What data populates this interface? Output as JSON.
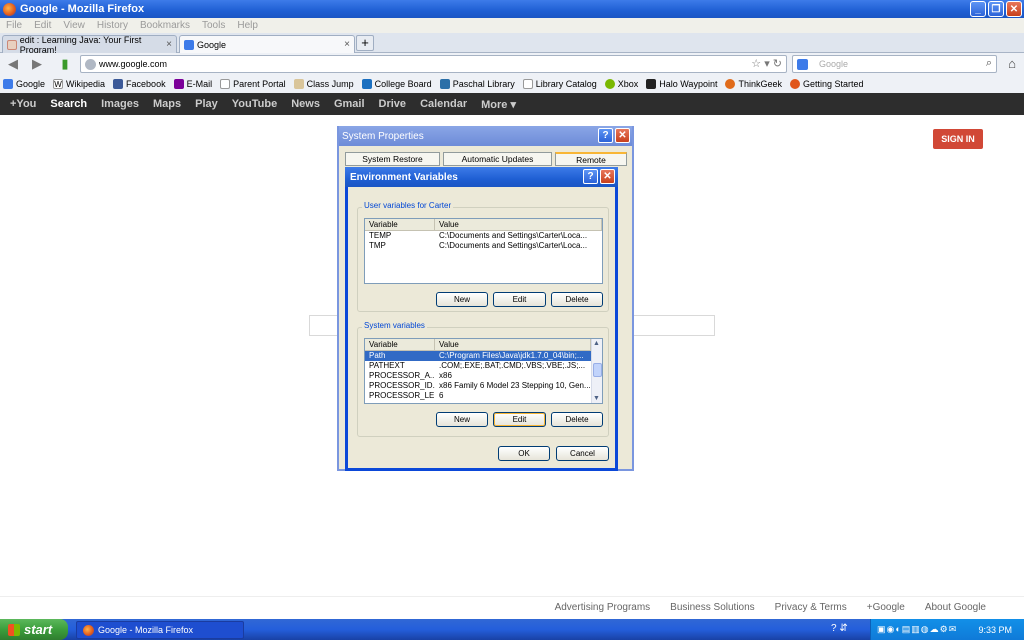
{
  "window": {
    "title": "Google - Mozilla Firefox"
  },
  "menu": [
    "File",
    "Edit",
    "View",
    "History",
    "Bookmarks",
    "Tools",
    "Help"
  ],
  "tabs": [
    {
      "label": "edit : Learning Java: Your First Program!"
    },
    {
      "label": "Google"
    }
  ],
  "nav": {
    "url": "www.google.com",
    "search_placeholder": "Google"
  },
  "bookmarks": [
    "Google",
    "Wikipedia",
    "Facebook",
    "E-Mail",
    "Parent Portal",
    "Class Jump",
    "College Board",
    "Paschal Library",
    "Library Catalog",
    "Xbox",
    "Halo Waypoint",
    "ThinkGeek",
    "Getting Started"
  ],
  "gbar": [
    "+You",
    "Search",
    "Images",
    "Maps",
    "Play",
    "YouTube",
    "News",
    "Gmail",
    "Drive",
    "Calendar",
    "More ▾"
  ],
  "signin": "SIGN IN",
  "footer": [
    "Advertising Programs",
    "Business Solutions",
    "Privacy & Terms",
    "+Google",
    "About Google"
  ],
  "sysprop": {
    "title": "System Properties",
    "tabs": [
      "System Restore",
      "Automatic Updates",
      "Remote"
    ]
  },
  "envvar": {
    "title": "Environment Variables",
    "user_group": "User variables for Carter",
    "system_group": "System variables",
    "col_variable": "Variable",
    "col_value": "Value",
    "user_vars": [
      {
        "name": "TEMP",
        "value": "C:\\Documents and Settings\\Carter\\Loca..."
      },
      {
        "name": "TMP",
        "value": "C:\\Documents and Settings\\Carter\\Loca..."
      }
    ],
    "system_vars": [
      {
        "name": "Path",
        "value": "C:\\Program Files\\Java\\jdk1.7.0_04\\bin;..."
      },
      {
        "name": "PATHEXT",
        "value": ".COM;.EXE;.BAT;.CMD;.VBS;.VBE;.JS;..."
      },
      {
        "name": "PROCESSOR_A...",
        "value": "x86"
      },
      {
        "name": "PROCESSOR_ID...",
        "value": "x86 Family 6 Model 23 Stepping 10, Gen..."
      },
      {
        "name": "PROCESSOR_LE...",
        "value": "6"
      }
    ],
    "new": "New",
    "edit": "Edit",
    "delete": "Delete",
    "ok": "OK",
    "cancel": "Cancel"
  },
  "taskbar": {
    "start": "start",
    "task": "Google - Mozilla Firefox",
    "clock": "9:33 PM"
  }
}
